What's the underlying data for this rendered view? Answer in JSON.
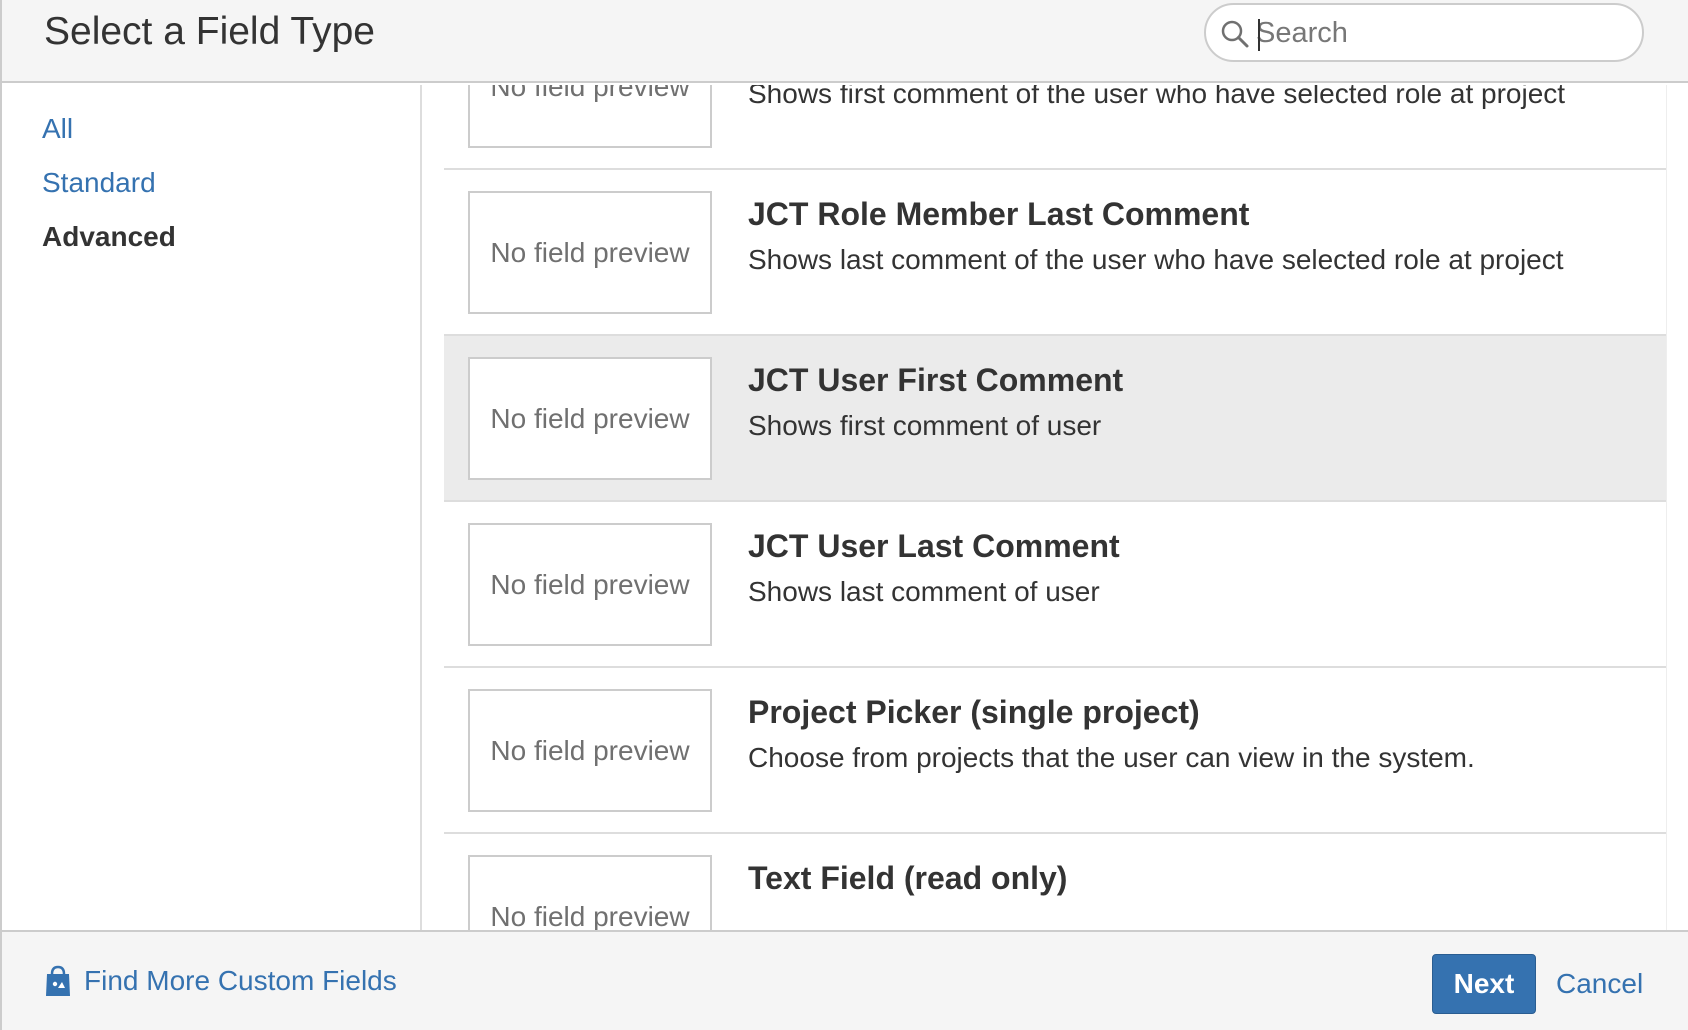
{
  "dialog": {
    "title": "Select a Field Type"
  },
  "search": {
    "placeholder": "Search",
    "value": ""
  },
  "sidebar": {
    "items": [
      {
        "label": "All",
        "active": false
      },
      {
        "label": "Standard",
        "active": false
      },
      {
        "label": "Advanced",
        "active": true
      }
    ]
  },
  "fields": [
    {
      "name": "",
      "description": "Shows first comment of the user who have selected role at project",
      "preview": "No field preview",
      "selected": false
    },
    {
      "name": "JCT Role Member Last Comment",
      "description": "Shows last comment of the user who have selected role at project",
      "preview": "No field preview",
      "selected": false
    },
    {
      "name": "JCT User First Comment",
      "description": "Shows first comment of user",
      "preview": "No field preview",
      "selected": true
    },
    {
      "name": "JCT User Last Comment",
      "description": "Shows last comment of user",
      "preview": "No field preview",
      "selected": false
    },
    {
      "name": "Project Picker (single project)",
      "description": "Choose from projects that the user can view in the system.",
      "preview": "No field preview",
      "selected": false
    },
    {
      "name": "Text Field (read only)",
      "description": "",
      "preview": "No field preview",
      "selected": false
    }
  ],
  "footer": {
    "find_more_label": "Find More Custom Fields",
    "next_label": "Next",
    "cancel_label": "Cancel"
  },
  "colors": {
    "link": "#3572b0",
    "primary_button": "#3572b0",
    "selected_row": "#ebebeb",
    "header_bg": "#f5f5f5"
  }
}
